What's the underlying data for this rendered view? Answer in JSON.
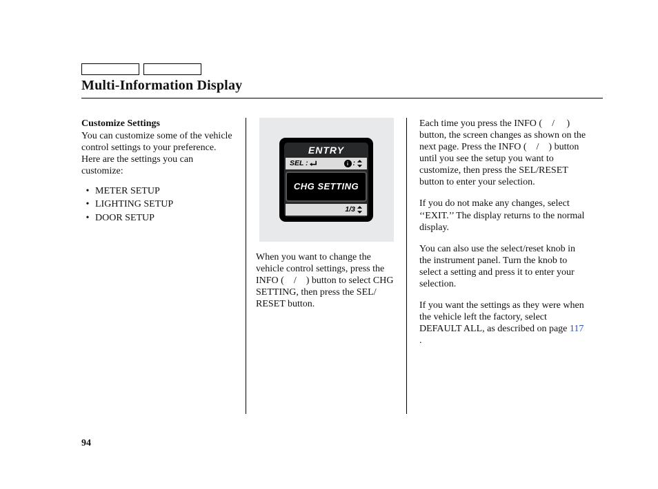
{
  "header": {
    "title": "Multi-Information Display"
  },
  "col1": {
    "subheading": "Customize Settings",
    "intro": "You can customize some of the vehicle control settings to your preference. Here are the settings you can customize:",
    "bullets": [
      "METER SETUP",
      "LIGHTING SETUP",
      "DOOR SETUP"
    ]
  },
  "col2": {
    "device": {
      "entry": "ENTRY",
      "sel_label": "SEL :",
      "info_label": ":",
      "body": "CHG SETTING",
      "page_indicator": "1/3"
    },
    "para1": "When you want to change the vehicle control settings, press the INFO (    /    ) button to select CHG SETTING, then press the SEL/ RESET button."
  },
  "col3": {
    "para1": "Each time you press the INFO (    /     ) button, the screen changes as shown on the next page. Press the INFO (    /    ) button until you see the setup you want to customize, then press the SEL/RESET button to enter your selection.",
    "para2": "If you do not make any changes, select ‘‘EXIT.’’ The display returns to the normal display.",
    "para3": "You can also use the select/reset knob in the instrument panel. Turn the knob to select a setting and press it to enter your selection.",
    "para4_pre": "If you want the settings as they were when the vehicle left the factory, select DEFAULT ALL, as described on page ",
    "para4_link": "117",
    "para4_post": " ."
  },
  "page_number": "94"
}
